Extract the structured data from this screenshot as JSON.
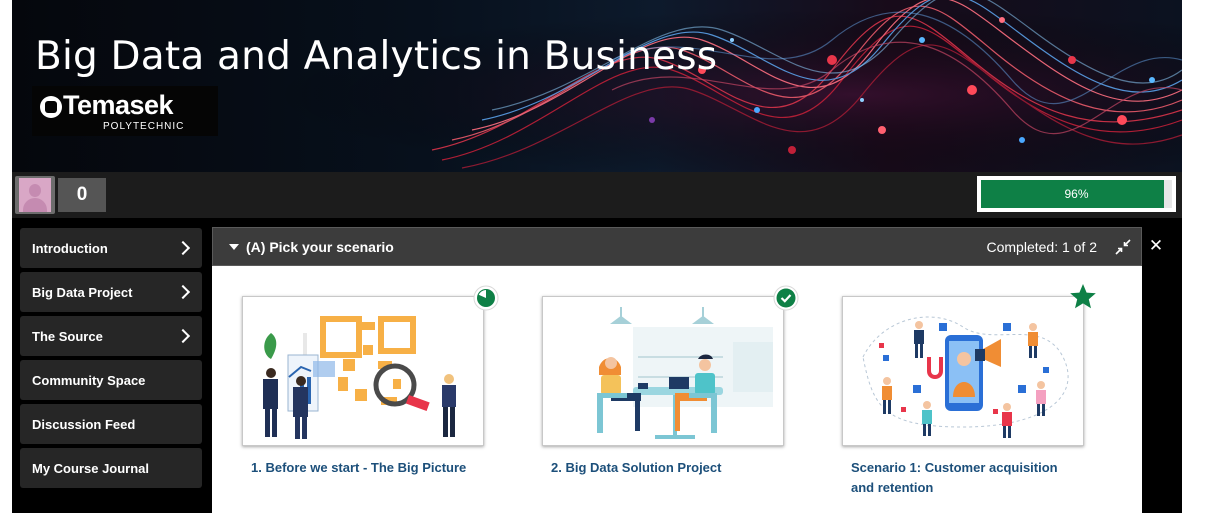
{
  "banner": {
    "title": "Big Data and Analytics in Business"
  },
  "logo": {
    "name": "Temasek",
    "sub": "POLYTECHNIC"
  },
  "status": {
    "points": "0",
    "progress_label": "96%",
    "progress_value": 0.96,
    "progress_color": "#0e8046"
  },
  "sidebar": {
    "items": [
      {
        "label": "Introduction",
        "has_chevron": true
      },
      {
        "label": "Big Data Project",
        "has_chevron": true
      },
      {
        "label": "The Source",
        "has_chevron": true
      },
      {
        "label": "Community Space",
        "has_chevron": false
      },
      {
        "label": "Discussion Feed",
        "has_chevron": false
      },
      {
        "label": "My Course Journal",
        "has_chevron": false
      }
    ]
  },
  "panel": {
    "title": "(A) Pick your scenario",
    "completed": "Completed: 1 of 2",
    "cards": [
      {
        "title": "1. Before we start - The Big Picture",
        "status_icon": "partial-progress-icon"
      },
      {
        "title": "2. Big Data Solution Project",
        "status_icon": "completed-check-icon"
      },
      {
        "title": "Scenario 1: Customer acquisition and retention",
        "status_icon": "star-icon"
      }
    ]
  },
  "colors": {
    "accent_green": "#0e8046",
    "link_blue": "#1c4f7a",
    "sidebar_bg": "#262626"
  }
}
